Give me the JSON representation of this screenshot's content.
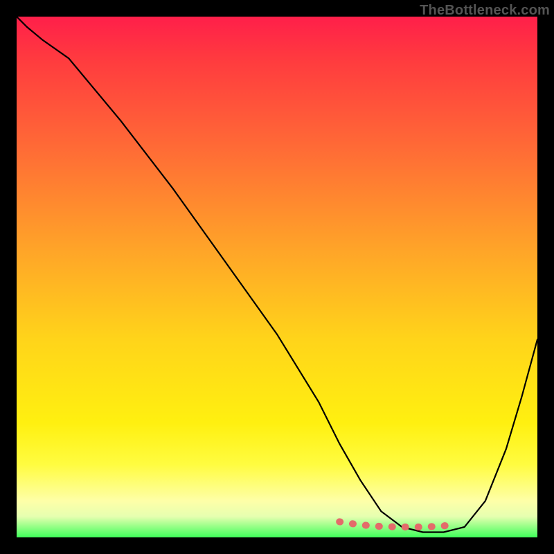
{
  "watermark": "TheBottleneck.com",
  "chart_data": {
    "type": "line",
    "title": "",
    "xlabel": "",
    "ylabel": "",
    "xlim": [
      0,
      100
    ],
    "ylim": [
      0,
      100
    ],
    "gradient_stops": [
      {
        "pos": 0,
        "color": "#ff1f4a"
      },
      {
        "pos": 8,
        "color": "#ff3a3f"
      },
      {
        "pos": 25,
        "color": "#ff6a36"
      },
      {
        "pos": 45,
        "color": "#ffa528"
      },
      {
        "pos": 62,
        "color": "#ffd41a"
      },
      {
        "pos": 78,
        "color": "#fff010"
      },
      {
        "pos": 86,
        "color": "#fffc40"
      },
      {
        "pos": 93,
        "color": "#feffa8"
      },
      {
        "pos": 96,
        "color": "#e6ffb0"
      },
      {
        "pos": 100,
        "color": "#3fff5a"
      }
    ],
    "series": [
      {
        "name": "bottleneck-curve",
        "color": "#000000",
        "x": [
          0,
          2,
          5,
          10,
          20,
          30,
          40,
          50,
          58,
          62,
          66,
          70,
          74,
          78,
          82,
          86,
          90,
          94,
          97,
          100
        ],
        "y": [
          100,
          98,
          95.5,
          92,
          80,
          67,
          53,
          39,
          26,
          18,
          11,
          5,
          2,
          1,
          1,
          2,
          7,
          17,
          27,
          38
        ]
      }
    ],
    "highlight_band": {
      "name": "optimal-range",
      "color": "#e46a6a",
      "x": [
        62,
        66,
        70,
        74,
        78,
        82,
        84
      ],
      "y": [
        3.0,
        2.4,
        2.1,
        2.0,
        2.0,
        2.2,
        2.6
      ]
    }
  }
}
